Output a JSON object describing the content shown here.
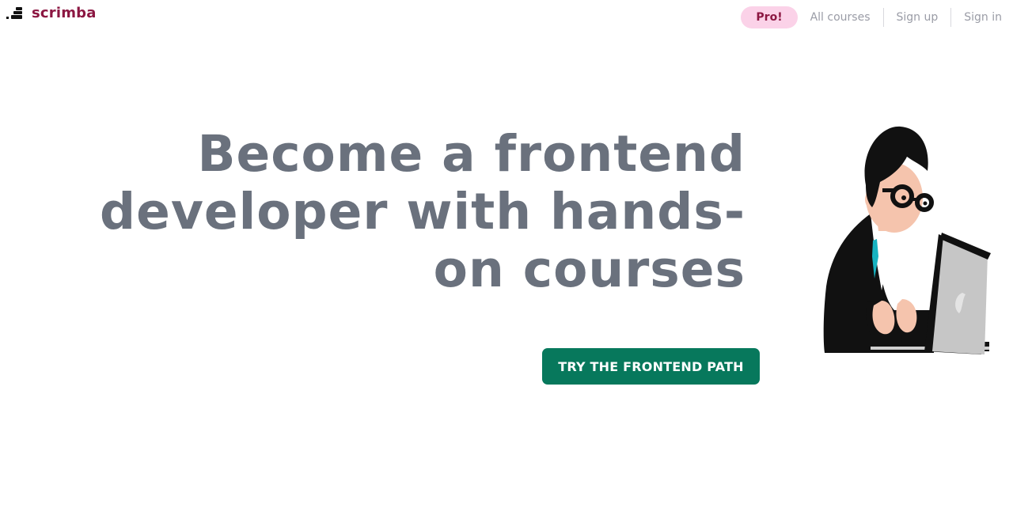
{
  "header": {
    "logo_text": "scrimba",
    "logo_icon": "scrimba-logo-icon",
    "pro_label": "Pro!",
    "nav_links": [
      "All courses",
      "Sign up",
      "Sign in"
    ]
  },
  "hero": {
    "headline": "Become a frontend developer with hands-on courses",
    "cta_label": "TRY THE FRONTEND PATH",
    "illustration": "developer-at-laptop-illustration"
  },
  "colors": {
    "brand": "#8c1742",
    "pro_pill_bg": "#fbd2e8",
    "headline": "#6a717d",
    "cta_bg": "#07785c",
    "nav_link": "#9a9ca6"
  }
}
